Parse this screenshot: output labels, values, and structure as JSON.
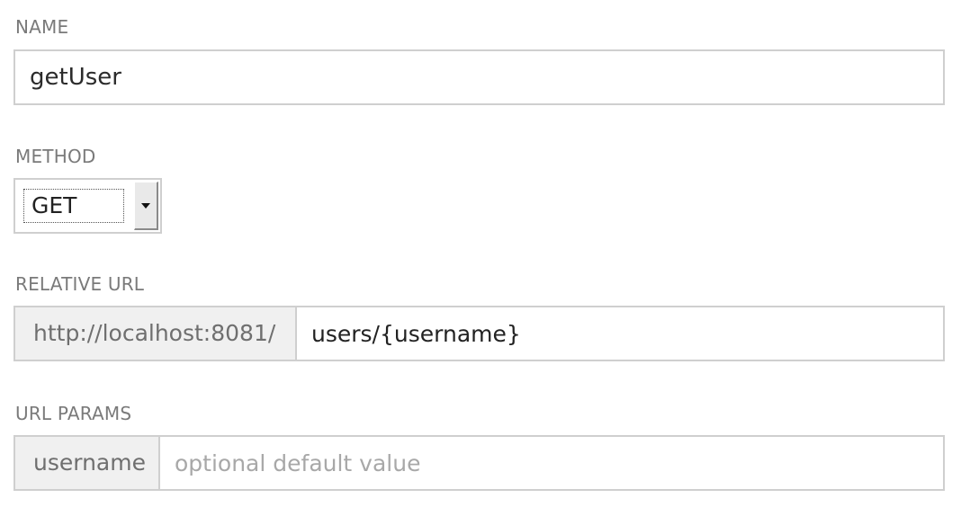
{
  "name_section": {
    "label": "NAME",
    "value": "getUser"
  },
  "method_section": {
    "label": "METHOD",
    "selected": "GET"
  },
  "relative_url_section": {
    "label": "RELATIVE URL",
    "base_url": "http://localhost:8081/",
    "path_value": "users/{username}"
  },
  "url_params_section": {
    "label": "URL PARAMS",
    "params": [
      {
        "name": "username",
        "placeholder": "optional default value",
        "value": ""
      }
    ]
  }
}
